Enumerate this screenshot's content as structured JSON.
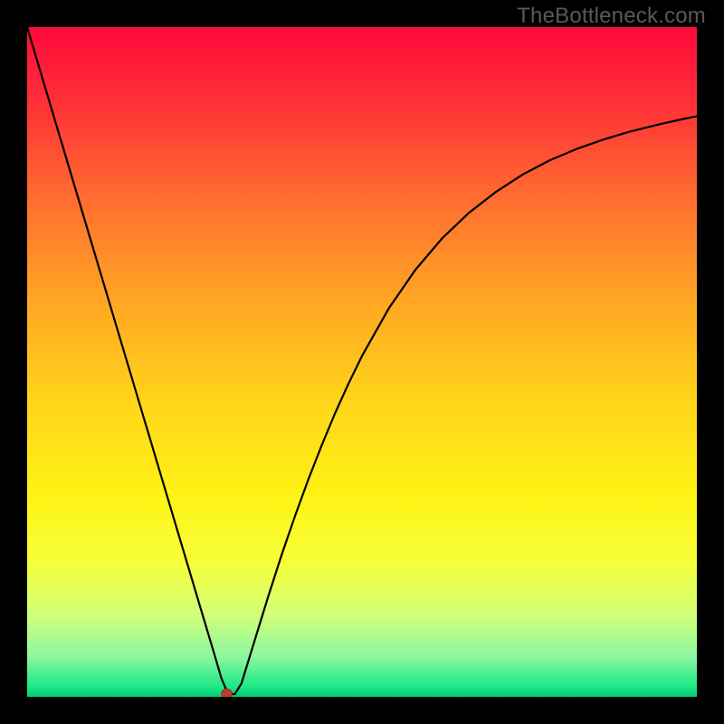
{
  "watermark": "TheBottleneck.com",
  "chart_data": {
    "type": "line",
    "title": "",
    "xlabel": "",
    "ylabel": "",
    "xlim": [
      0,
      100
    ],
    "ylim": [
      0,
      100
    ],
    "grid": false,
    "series": [
      {
        "name": "bottleneck-curve",
        "x": [
          0,
          2,
          4,
          6,
          8,
          10,
          12,
          14,
          16,
          18,
          20,
          22,
          24,
          26,
          28,
          29,
          30,
          31,
          32,
          34,
          36,
          38,
          40,
          42,
          44,
          46,
          48,
          50,
          54,
          58,
          62,
          66,
          70,
          74,
          78,
          82,
          86,
          90,
          94,
          98,
          100
        ],
        "values": [
          100,
          93.3,
          86.6,
          79.9,
          73.2,
          66.5,
          59.8,
          53.1,
          46.4,
          39.7,
          33.0,
          26.3,
          19.6,
          12.9,
          6.2,
          2.8,
          0.4,
          0.4,
          2.0,
          8.5,
          15.0,
          21.2,
          27.0,
          32.5,
          37.6,
          42.4,
          46.8,
          50.9,
          58.0,
          63.8,
          68.5,
          72.3,
          75.4,
          78.0,
          80.1,
          81.8,
          83.2,
          84.4,
          85.4,
          86.3,
          86.7
        ]
      }
    ],
    "marker": {
      "x": 29.8,
      "y": 0,
      "color": "#c0392b",
      "radius": 5
    },
    "background_gradient": {
      "stops": [
        {
          "offset": 0.0,
          "color": "#ff0a3a"
        },
        {
          "offset": 0.1,
          "color": "#ff2b38"
        },
        {
          "offset": 0.25,
          "color": "#ff6a30"
        },
        {
          "offset": 0.4,
          "color": "#ffa324"
        },
        {
          "offset": 0.55,
          "color": "#ffd21a"
        },
        {
          "offset": 0.7,
          "color": "#fff314"
        },
        {
          "offset": 0.8,
          "color": "#f6ff3a"
        },
        {
          "offset": 0.88,
          "color": "#cfff7a"
        },
        {
          "offset": 0.94,
          "color": "#8cf7a0"
        },
        {
          "offset": 0.985,
          "color": "#1de887"
        },
        {
          "offset": 1.0,
          "color": "#06c97a"
        }
      ]
    }
  }
}
